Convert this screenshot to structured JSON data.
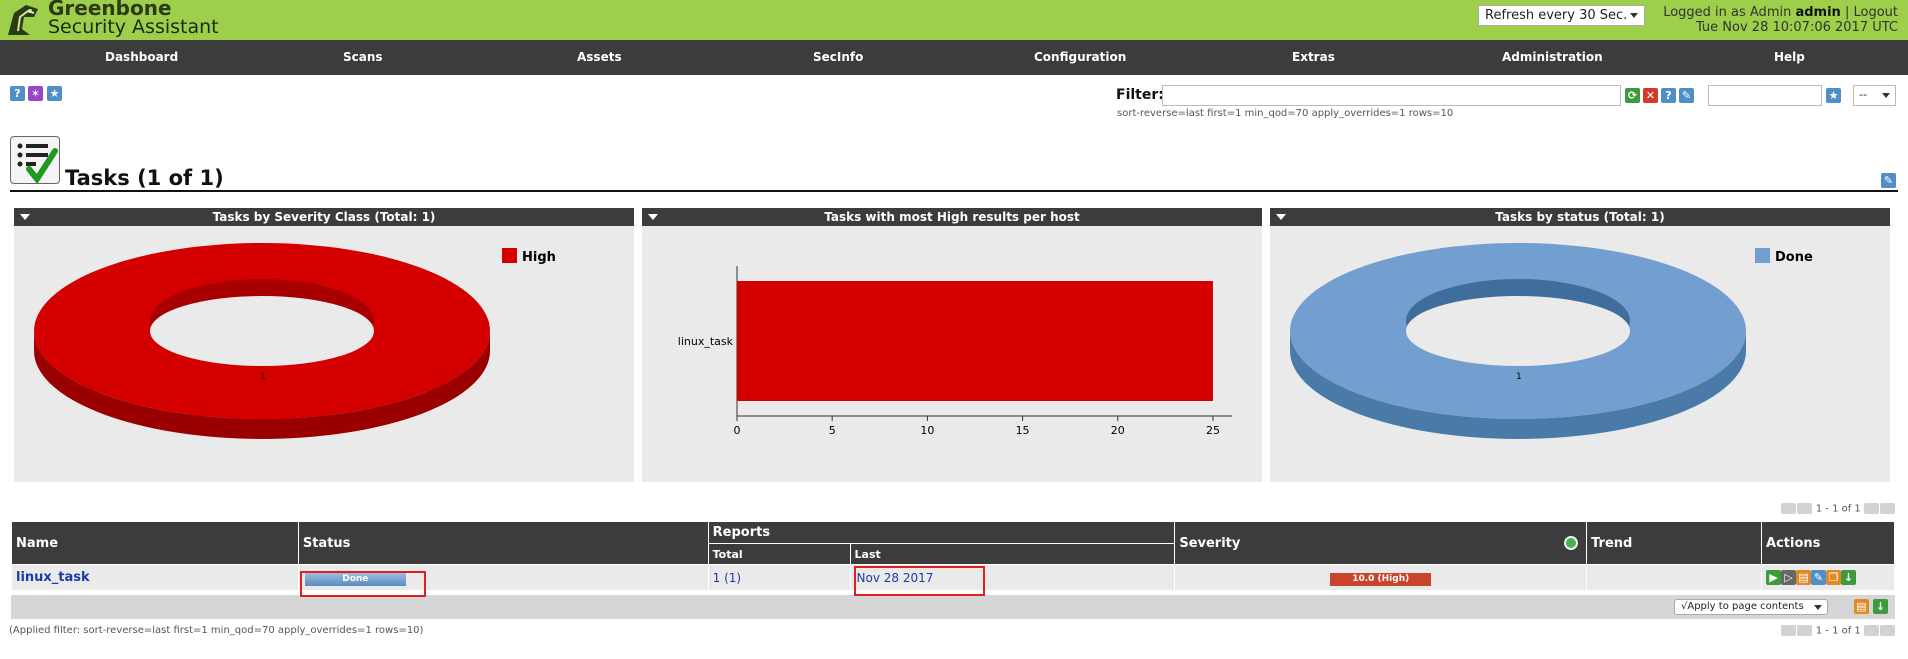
{
  "brand": {
    "line1": "Greenbone",
    "line2": "Security Assistant"
  },
  "header": {
    "refresh_label": "Refresh every 30 Sec.",
    "logged_in_prefix": "Logged in as  Admin ",
    "user": "admin",
    "separator": "|",
    "logout": "Logout",
    "datetime": "Tue Nov 28 10:07:06 2017 UTC"
  },
  "nav": [
    "Dashboard",
    "Scans",
    "Assets",
    "SecInfo",
    "Configuration",
    "Extras",
    "Administration",
    "Help"
  ],
  "filter": {
    "label": "Filter:",
    "value": "",
    "string": "sort-reverse=last first=1 min_qod=70 apply_overrides=1 rows=10",
    "select_value": "--"
  },
  "page": {
    "title": "Tasks (1 of 1)"
  },
  "panels": [
    {
      "title": "Tasks by Severity Class (Total: 1)",
      "legend": "High",
      "value_label": "1",
      "color": "#d40000"
    },
    {
      "title": "Tasks with most High results per host"
    },
    {
      "title": "Tasks by status (Total: 1)",
      "legend": "Done",
      "value_label": "1",
      "color": "#729fcf"
    }
  ],
  "chart_data": {
    "type": "bar",
    "title": "Tasks with most High results per host",
    "categories": [
      "linux_task"
    ],
    "values": [
      25
    ],
    "xlim": [
      0,
      26
    ],
    "ticks": [
      "0",
      "5",
      "10",
      "15",
      "20",
      "25"
    ],
    "color": "#d40000"
  },
  "pagination": "1 - 1 of 1",
  "table": {
    "headers": {
      "name": "Name",
      "status": "Status",
      "reports": "Reports",
      "total": "Total",
      "last": "Last",
      "severity": "Severity",
      "trend": "Trend",
      "actions": "Actions"
    },
    "rows": [
      {
        "name": "linux_task",
        "status": "Done",
        "total": "1 (1)",
        "last": "Nov 28 2017",
        "severity": "10.0 (High)",
        "trend": ""
      }
    ],
    "apply_label": "√Apply to page contents"
  },
  "applied_filter": "(Applied filter: sort-reverse=last first=1 min_qod=70 apply_overrides=1 rows=10)",
  "colors": {
    "accent_green": "#9ecf4a",
    "nav_dark": "#3c3c3c",
    "severity_high": "#d40000",
    "status_done": "#729fcf"
  }
}
